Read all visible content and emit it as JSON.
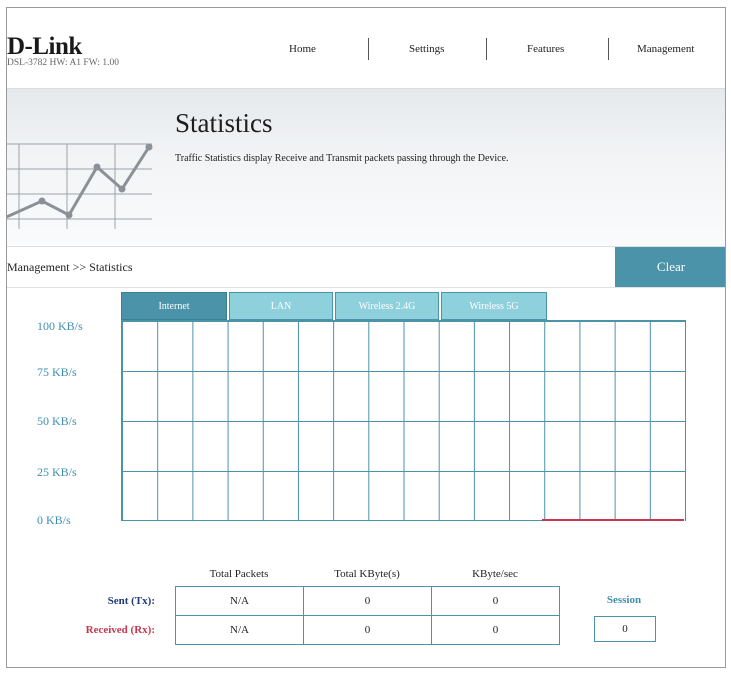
{
  "brand": {
    "logo": "D-Link",
    "hw_info": "DSL-3782  HW: A1  FW: 1.00"
  },
  "nav": {
    "items": [
      "Home",
      "Settings",
      "Features",
      "Management"
    ]
  },
  "banner": {
    "title": "Statistics",
    "description": "Traffic Statistics display Receive and Transmit packets passing through the Device."
  },
  "breadcrumb": "Management >> Statistics",
  "clear_label": "Clear",
  "tabs": [
    "Internet",
    "LAN",
    "Wireless 2.4G",
    "Wireless 5G"
  ],
  "active_tab": "Internet",
  "graph": {
    "y_labels": [
      "100 KB/s",
      "75 KB/s",
      "50 KB/s",
      "25 KB/s",
      "0 KB/s"
    ]
  },
  "stats": {
    "headers": [
      "Total Packets",
      "Total KByte(s)",
      "KByte/sec"
    ],
    "rows": [
      {
        "label": "Sent (Tx):",
        "values": [
          "N/A",
          "0",
          "0"
        ]
      },
      {
        "label": "Received (Rx):",
        "values": [
          "N/A",
          "0",
          "0"
        ]
      }
    ],
    "session_label": "Session",
    "session_value": "0"
  },
  "colors": {
    "accent": "#4a93a8",
    "tab_inactive": "#8fd0dd",
    "sent": "#1f3b7a",
    "received": "#c3384f"
  }
}
